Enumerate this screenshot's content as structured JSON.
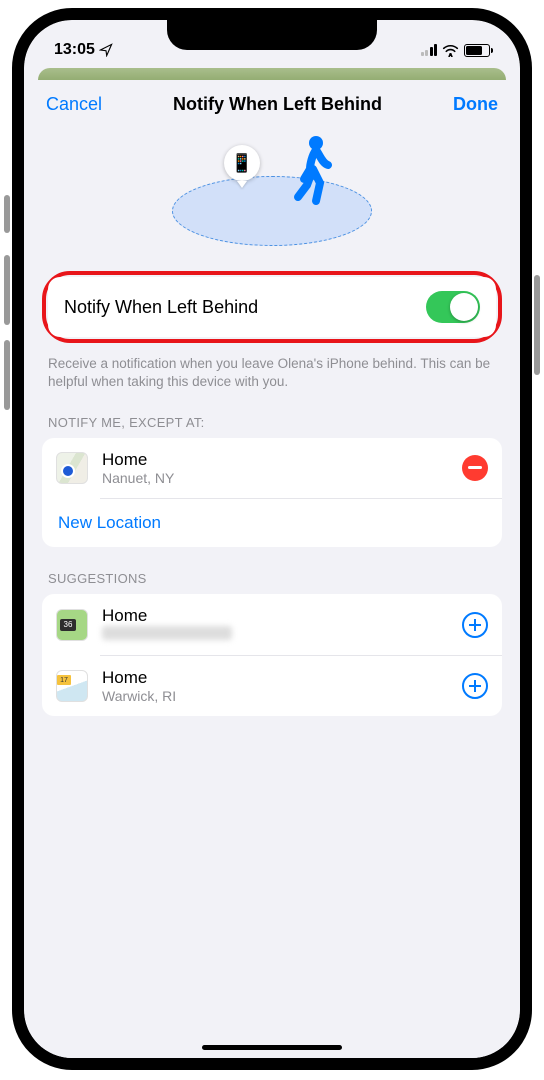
{
  "status": {
    "time": "13:05"
  },
  "nav": {
    "cancel": "Cancel",
    "title": "Notify When Left Behind",
    "done": "Done"
  },
  "toggle": {
    "label": "Notify When Left Behind",
    "on": true
  },
  "description": "Receive a notification when you leave Olena's iPhone behind. This can be helpful when taking this device with you.",
  "exceptHeader": "NOTIFY ME, EXCEPT AT:",
  "exceptions": [
    {
      "title": "Home",
      "subtitle": "Nanuet, NY"
    }
  ],
  "newLocation": "New Location",
  "suggestionsHeader": "SUGGESTIONS",
  "suggestions": [
    {
      "title": "Home",
      "subtitle": "",
      "badge": "36",
      "subtitleRedacted": true
    },
    {
      "title": "Home",
      "subtitle": "Warwick, RI",
      "road": "17"
    }
  ]
}
